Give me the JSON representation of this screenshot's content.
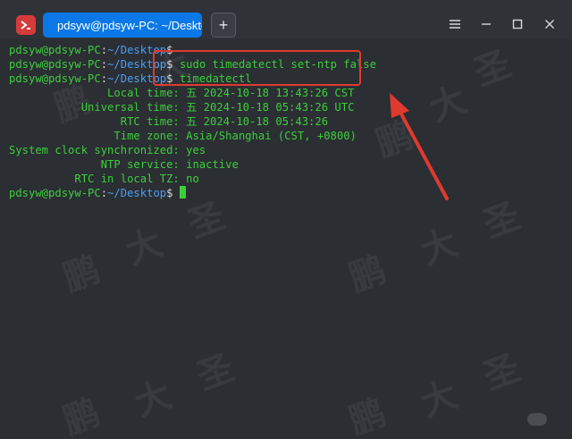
{
  "window": {
    "tab_title": "pdsyw@pdsyw-PC: ~/Desktop",
    "new_tab_label": "+"
  },
  "terminal": {
    "prompt": {
      "user": "pdsyw@pdsyw-PC",
      "colon": ":",
      "path": "~/Desktop",
      "dollar": "$"
    },
    "commands": [
      "",
      "sudo timedatectl set-ntp false",
      "timedatectl"
    ],
    "output": [
      {
        "label": "               Local time:",
        "value": " 五 2024-10-18 13:43:26 CST"
      },
      {
        "label": "           Universal time:",
        "value": " 五 2024-10-18 05:43:26 UTC"
      },
      {
        "label": "                 RTC time:",
        "value": " 五 2024-10-18 05:43:26"
      },
      {
        "label": "                Time zone:",
        "value": " Asia/Shanghai (CST, +0800)"
      },
      {
        "label": "System clock synchronized:",
        "value": " yes"
      },
      {
        "label": "              NTP service:",
        "value": " inactive"
      },
      {
        "label": "          RTC in local TZ:",
        "value": " no"
      }
    ]
  },
  "watermark_chars": [
    "鹏",
    "大",
    "圣"
  ],
  "colors": {
    "green": "#3bcf3b",
    "path_blue": "#4a9ff5",
    "tab_blue": "#0a78e6",
    "annotation_red": "#e03a2e"
  }
}
